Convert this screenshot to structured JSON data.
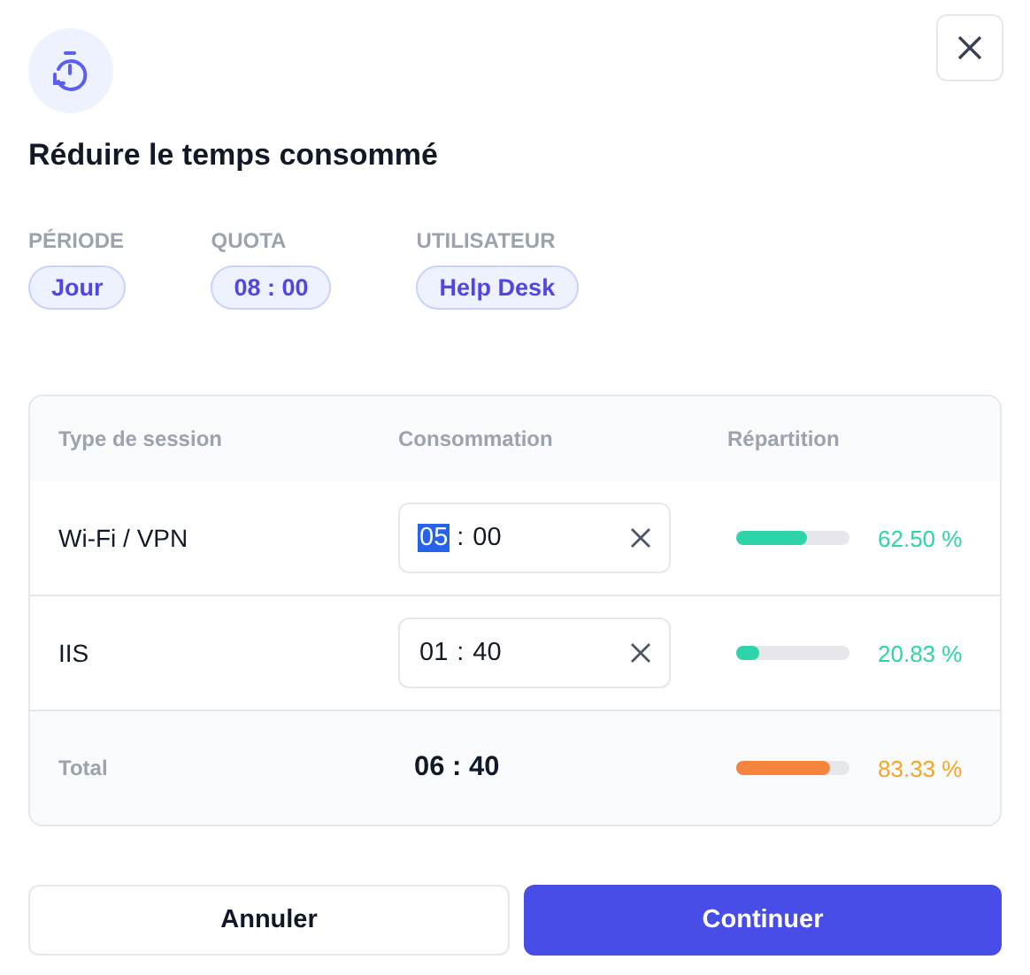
{
  "dialog": {
    "title": "Réduire le temps consommé"
  },
  "meta": [
    {
      "label": "PÉRIODE",
      "value": "Jour"
    },
    {
      "label": "QUOTA",
      "value": "08 : 00"
    },
    {
      "label": "UTILISATEUR",
      "value": "Help Desk"
    }
  ],
  "table": {
    "columns": [
      "Type de session",
      "Consommation",
      "Répartition"
    ],
    "rows": [
      {
        "type": "Wi-Fi / VPN",
        "time": [
          {
            "text": "05",
            "selected": true
          },
          {
            "text": "00",
            "selected": false
          }
        ],
        "separator": ":",
        "level": 0.625,
        "share": "62.50 %",
        "color": "#2dd4aa"
      },
      {
        "type": "IIS",
        "time": [
          {
            "text": "01",
            "selected": false
          },
          {
            "text": "40",
            "selected": false
          }
        ],
        "separator": ":",
        "level": 0.2083,
        "share": "20.83 %",
        "color": "#2dd4aa"
      }
    ],
    "total": {
      "label": "Total",
      "value": "06 : 40",
      "level": 0.8333,
      "share": "83.33 %",
      "color": "#f5843f"
    }
  },
  "buttons": {
    "cancel": "Annuler",
    "confirm": "Continuer"
  }
}
